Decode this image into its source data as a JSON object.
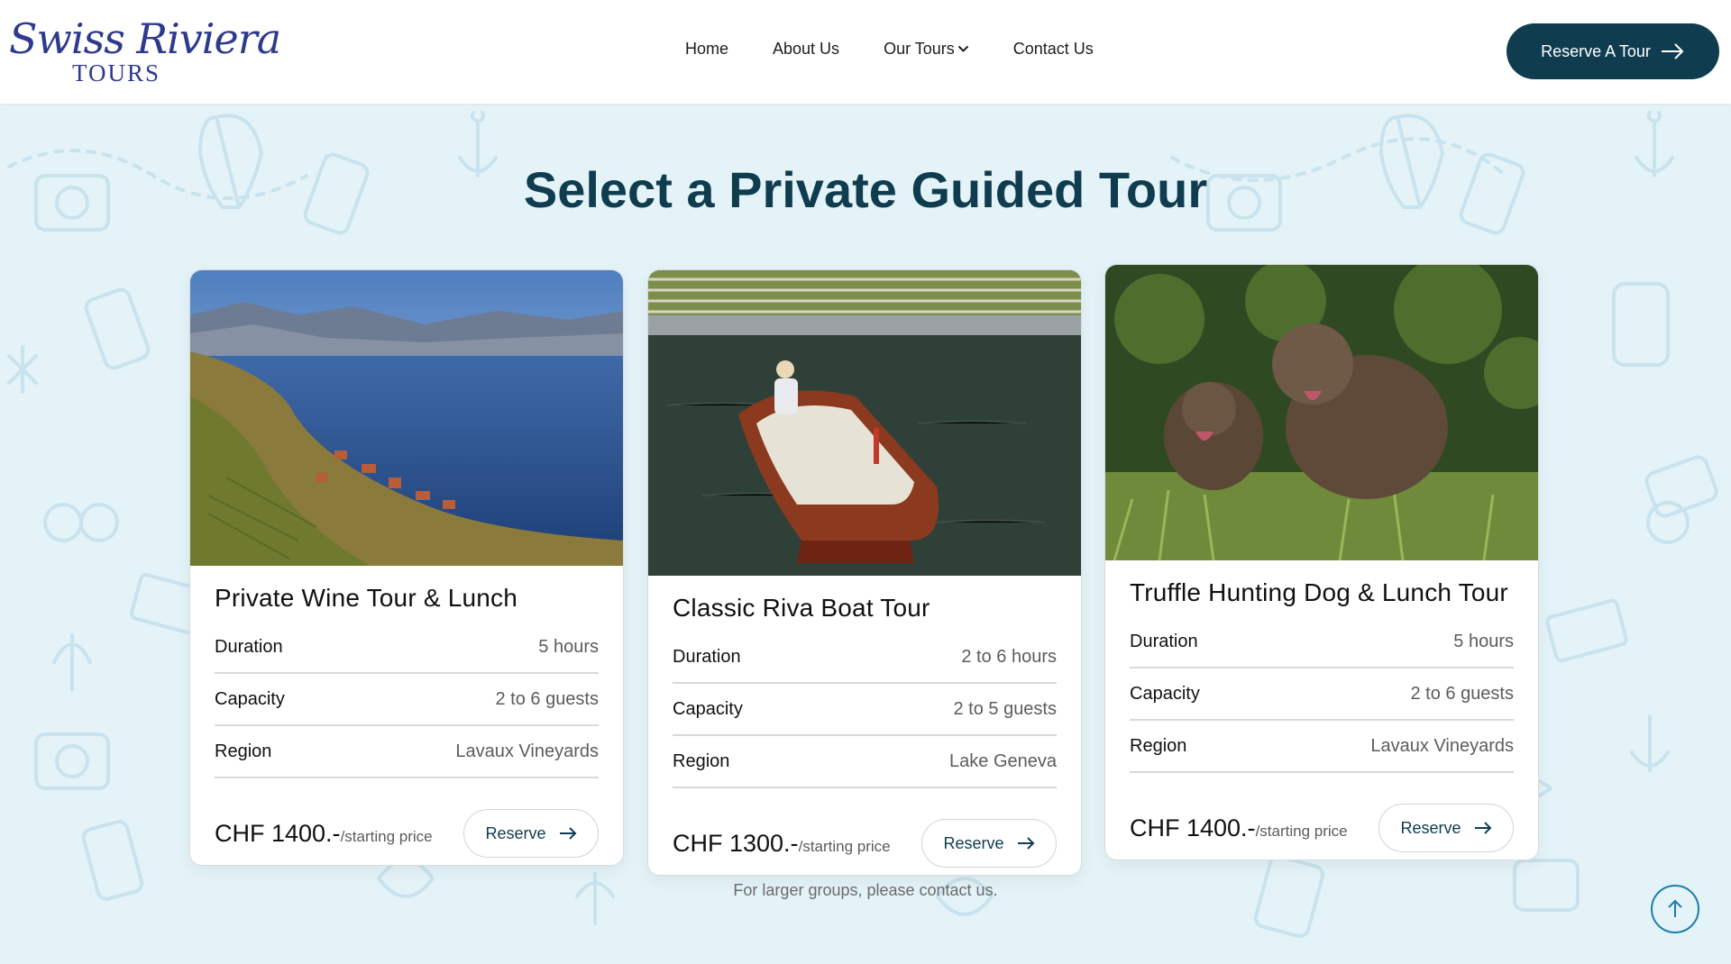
{
  "brand": {
    "script": "Swiss Riviera",
    "sub": "TOURS"
  },
  "nav": {
    "home": "Home",
    "about": "About Us",
    "tours": "Our Tours",
    "contact": "Contact Us"
  },
  "header_cta": "Reserve A Tour",
  "title": "Select a Private Guided Tour",
  "labels": {
    "duration": "Duration",
    "capacity": "Capacity",
    "region": "Region",
    "reserve": "Reserve",
    "price_note": "/starting price"
  },
  "tours": [
    {
      "title": "Private Wine Tour & Lunch",
      "duration": "5 hours",
      "capacity": "2 to 6 guests",
      "region": "Lavaux Vineyards",
      "price": "CHF 1400.-"
    },
    {
      "title": "Classic Riva Boat Tour",
      "duration": "2 to 6 hours",
      "capacity": "2 to 5 guests",
      "region": "Lake Geneva",
      "price": "CHF 1300.-"
    },
    {
      "title": "Truffle Hunting Dog & Lunch Tour",
      "duration": "5 hours",
      "capacity": "2 to 6 guests",
      "region": "Lavaux Vineyards",
      "price": "CHF 1400.-"
    }
  ],
  "footnote": "For larger groups, please contact us.",
  "colors": {
    "brand": "#2e3a8c",
    "primary": "#0f3d4f",
    "background": "#e4f3f8",
    "accent": "#1e7da8"
  },
  "icons": {
    "chevron": "chevron-down-icon",
    "arrow": "arrow-right-icon",
    "scroll_top": "arrow-up-icon"
  }
}
